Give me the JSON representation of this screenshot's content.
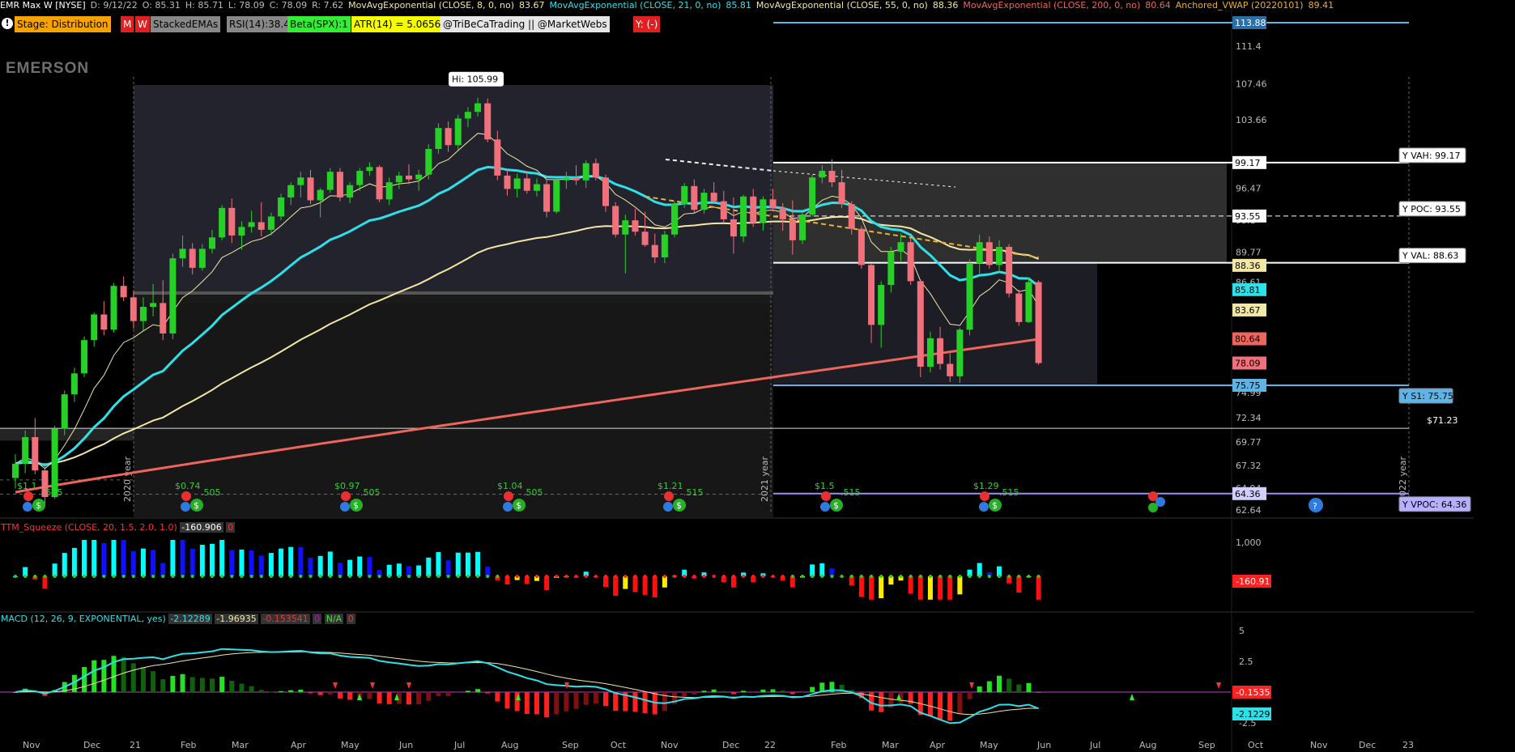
{
  "header": {
    "symbol": "EMR Max W [NYSE]",
    "date": "D: 9/12/22",
    "open": "O: 85.31",
    "high": "H: 85.71",
    "low": "L: 78.09",
    "close": "C: 78.09",
    "range": "R: 7.62",
    "ema8_label": "MovAvgExponential (CLOSE, 8, 0, no)",
    "ema8_val": "83.67",
    "ema21_label": "MovAvgExponential (CLOSE, 21, 0, no)",
    "ema21_val": "85.81",
    "ema55_label": "MovAvgExponential (CLOSE, 55, 0, no)",
    "ema55_val": "88.36",
    "ema200_label": "MovAvgExponential (CLOSE, 200, 0, no)",
    "ema200_val": "80.64",
    "vwap_label": "Anchored_VWAP (20220101)",
    "vwap_val": "89.41"
  },
  "badges": {
    "stage": "Stage: Distribution",
    "m": "M",
    "w": "W",
    "stacked": "StackedEMAs",
    "rsi": "RSI(14):38.4",
    "beta": "Beta(SPX):1",
    "atr": "ATR(14) = 5.0656",
    "handle": "@TriBeCaTrading || @MarketWebs",
    "y": "Y: (-)"
  },
  "logo": "EMERSON",
  "price_labels": {
    "hi": "Hi: 105.99",
    "vah": "Y VAH: 99.17",
    "poc": "Y POC: 93.55",
    "val": "Y VAL: 88.63",
    "s1": "Y S1: 75.75",
    "vpoc": "Y VPOC: 64.36",
    "level": "$71.23",
    "top": "113.88"
  },
  "right_axis": {
    "ticks": [
      "111.4",
      "107.46",
      "103.66",
      "96.47",
      "93.1",
      "89.77",
      "86.61",
      "74.99",
      "72.34",
      "69.77",
      "67.32",
      "64.94",
      "62.64"
    ],
    "tags": [
      "113.88",
      "99.17",
      "93.55",
      "88.36",
      "85.81",
      "83.67",
      "80.64",
      "78.09",
      "75.75",
      "64.36"
    ]
  },
  "year_markers": [
    "2020 year",
    "2021 year",
    "2022 year"
  ],
  "dividends": [
    "$1.1",
    "$0.74",
    "$0.97",
    "$1.04",
    "$1.21",
    "$1.5",
    "$1.29"
  ],
  "dividend_values": [
    ".505",
    ".505",
    ".505",
    ".505",
    ".515",
    ".515",
    ".515"
  ],
  "ttm": {
    "label": "TTM_Squeeze (CLOSE, 20, 1.5, 2.0, 1.0)",
    "val": "-160.906",
    "zero": "0",
    "axis": "1,000",
    "tag": "-160.91"
  },
  "macd": {
    "label": "MACD (12, 26, 9, EXPONENTIAL, yes)",
    "v1": "-2.12289",
    "v2": "-1.96935",
    "v3": "-0.153541",
    "v4": "0",
    "v5": "N/A",
    "v6": "0",
    "axis": [
      "5",
      "2.5",
      "0",
      "-2.5"
    ],
    "tags": [
      "-0.1535",
      "-2.1229"
    ]
  },
  "x_axis": [
    "Nov",
    "Dec",
    "21",
    "Feb",
    "Mar",
    "Apr",
    "May",
    "Jun",
    "Jul",
    "Aug",
    "Sep",
    "Oct",
    "Nov",
    "Dec",
    "22",
    "Feb",
    "Mar",
    "Apr",
    "May",
    "Jun",
    "Jul",
    "Aug",
    "Sep",
    "Oct",
    "Nov",
    "Dec",
    "23"
  ],
  "colors": {
    "up": "#26d026",
    "down": "#f0707b",
    "ema8": "#ffffff",
    "ema21": "#2ee0e8",
    "ema55": "#f3e7a6",
    "ema200": "#f0655b",
    "vwap": "#e8b030",
    "level": "#5fb4e6"
  },
  "chart_data": {
    "type": "candlestick",
    "ylim": [
      62.64,
      113.88
    ],
    "levels": {
      "vah": 99.17,
      "poc": 93.55,
      "val": 88.63,
      "s1": 75.75,
      "vpoc": 64.36,
      "level": 71.23,
      "top": 113.88
    },
    "candles": [
      [
        66.0,
        68.5,
        64.9,
        67.5
      ],
      [
        67.5,
        71.0,
        66.5,
        70.3
      ],
      [
        70.3,
        72.3,
        66.4,
        66.8
      ],
      [
        66.8,
        67.6,
        63.2,
        64.0
      ],
      [
        64.0,
        71.5,
        63.8,
        71.2
      ],
      [
        71.2,
        75.2,
        70.5,
        74.8
      ],
      [
        74.8,
        77.6,
        74.0,
        77.0
      ],
      [
        77.0,
        80.9,
        76.6,
        80.5
      ],
      [
        80.5,
        83.4,
        79.8,
        83.2
      ],
      [
        83.2,
        84.6,
        81.0,
        81.6
      ],
      [
        81.6,
        86.5,
        81.3,
        86.2
      ],
      [
        86.2,
        87.2,
        84.6,
        85.0
      ],
      [
        85.0,
        85.7,
        81.7,
        82.5
      ],
      [
        82.5,
        85.0,
        81.5,
        84.0
      ],
      [
        84.0,
        86.4,
        83.0,
        84.4
      ],
      [
        84.4,
        86.8,
        80.5,
        81.2
      ],
      [
        81.2,
        89.6,
        80.6,
        89.1
      ],
      [
        89.1,
        91.5,
        88.2,
        90.1
      ],
      [
        90.1,
        90.7,
        87.4,
        88.1
      ],
      [
        88.1,
        90.6,
        87.8,
        90.1
      ],
      [
        90.1,
        92.1,
        89.6,
        91.3
      ],
      [
        91.3,
        94.7,
        91.0,
        94.4
      ],
      [
        94.4,
        95.4,
        90.7,
        91.5
      ],
      [
        91.5,
        93.0,
        90.0,
        92.4
      ],
      [
        92.4,
        94.1,
        91.8,
        92.9
      ],
      [
        92.9,
        95.0,
        91.4,
        92.1
      ],
      [
        92.1,
        93.9,
        91.5,
        93.5
      ],
      [
        93.5,
        95.9,
        93.1,
        95.5
      ],
      [
        95.5,
        97.1,
        94.7,
        96.8
      ],
      [
        96.8,
        98.2,
        95.5,
        97.6
      ],
      [
        97.6,
        98.4,
        94.8,
        95.2
      ],
      [
        95.2,
        96.5,
        93.4,
        96.3
      ],
      [
        96.3,
        98.6,
        96.0,
        98.2
      ],
      [
        98.2,
        98.6,
        95.1,
        95.5
      ],
      [
        95.5,
        97.1,
        94.9,
        96.8
      ],
      [
        96.8,
        98.6,
        96.2,
        98.3
      ],
      [
        98.3,
        99.2,
        97.8,
        98.7
      ],
      [
        98.7,
        98.9,
        95.0,
        95.3
      ],
      [
        95.3,
        97.6,
        94.7,
        97.1
      ],
      [
        97.1,
        98.2,
        96.4,
        97.8
      ],
      [
        97.8,
        99.0,
        96.9,
        97.4
      ],
      [
        97.4,
        98.4,
        96.2,
        97.9
      ],
      [
        97.9,
        101.1,
        97.4,
        100.6
      ],
      [
        100.6,
        103.3,
        100.1,
        102.8
      ],
      [
        102.8,
        103.5,
        100.3,
        101.0
      ],
      [
        101.0,
        104.2,
        100.5,
        103.8
      ],
      [
        103.8,
        105.0,
        102.9,
        104.5
      ],
      [
        104.5,
        105.99,
        104.0,
        105.4
      ],
      [
        105.4,
        105.9,
        101.3,
        101.6
      ],
      [
        101.6,
        102.5,
        97.3,
        97.8
      ],
      [
        97.8,
        98.4,
        95.7,
        96.4
      ],
      [
        96.4,
        98.0,
        95.5,
        97.5
      ],
      [
        97.5,
        98.2,
        95.9,
        96.2
      ],
      [
        96.2,
        97.5,
        95.6,
        96.9
      ],
      [
        96.9,
        97.4,
        93.4,
        94.0
      ],
      [
        94.0,
        97.6,
        93.8,
        97.3
      ],
      [
        97.3,
        98.2,
        96.4,
        97.6
      ],
      [
        97.6,
        98.9,
        96.8,
        97.3
      ],
      [
        97.3,
        99.4,
        96.5,
        99.1
      ],
      [
        99.1,
        99.6,
        97.3,
        97.6
      ],
      [
        97.6,
        97.9,
        94.0,
        94.6
      ],
      [
        94.6,
        95.0,
        91.3,
        91.6
      ],
      [
        91.6,
        93.7,
        87.5,
        93.1
      ],
      [
        93.1,
        94.3,
        91.5,
        91.9
      ],
      [
        91.9,
        94.0,
        90.3,
        90.5
      ],
      [
        90.5,
        91.7,
        88.6,
        89.2
      ],
      [
        89.2,
        92.0,
        88.6,
        91.6
      ],
      [
        91.6,
        95.1,
        91.3,
        94.8
      ],
      [
        94.8,
        97.0,
        94.4,
        96.7
      ],
      [
        96.7,
        97.4,
        93.9,
        94.2
      ],
      [
        94.2,
        96.4,
        93.8,
        96.0
      ],
      [
        96.0,
        97.1,
        94.8,
        95.1
      ],
      [
        95.1,
        96.2,
        92.8,
        93.2
      ],
      [
        93.2,
        95.5,
        89.6,
        91.4
      ],
      [
        91.4,
        95.8,
        90.8,
        95.6
      ],
      [
        95.6,
        96.4,
        92.4,
        92.8
      ],
      [
        92.8,
        95.6,
        92.0,
        95.3
      ],
      [
        95.3,
        96.4,
        94.0,
        94.4
      ],
      [
        94.4,
        94.9,
        92.0,
        93.2
      ],
      [
        93.2,
        95.2,
        89.5,
        91.0
      ],
      [
        91.0,
        94.0,
        90.6,
        93.7
      ],
      [
        93.7,
        97.9,
        93.5,
        97.6
      ],
      [
        97.6,
        98.9,
        97.0,
        98.3
      ],
      [
        98.3,
        99.5,
        96.6,
        97.1
      ],
      [
        97.1,
        98.4,
        94.4,
        94.8
      ],
      [
        94.8,
        95.1,
        91.6,
        92.2
      ],
      [
        92.2,
        92.5,
        88.0,
        88.4
      ],
      [
        88.4,
        88.6,
        80.2,
        82.1
      ],
      [
        82.1,
        86.7,
        79.7,
        86.3
      ],
      [
        86.3,
        90.3,
        85.5,
        89.8
      ],
      [
        89.8,
        91.7,
        88.8,
        90.8
      ],
      [
        90.8,
        91.2,
        86.3,
        86.7
      ],
      [
        86.7,
        86.9,
        76.6,
        77.7
      ],
      [
        77.7,
        81.4,
        77.1,
        80.7
      ],
      [
        80.7,
        81.9,
        77.4,
        78.0
      ],
      [
        78.0,
        79.1,
        76.1,
        76.7
      ],
      [
        76.7,
        81.8,
        76.0,
        81.6
      ],
      [
        81.6,
        89.0,
        81.0,
        88.6
      ],
      [
        88.6,
        91.6,
        87.5,
        90.8
      ],
      [
        90.8,
        91.4,
        88.0,
        88.4
      ],
      [
        88.4,
        91.0,
        87.6,
        90.3
      ],
      [
        90.3,
        90.6,
        85.0,
        85.4
      ],
      [
        85.4,
        85.8,
        82.0,
        82.4
      ],
      [
        82.4,
        87.1,
        82.3,
        86.6
      ],
      [
        86.6,
        86.8,
        77.9,
        78.09
      ]
    ]
  }
}
